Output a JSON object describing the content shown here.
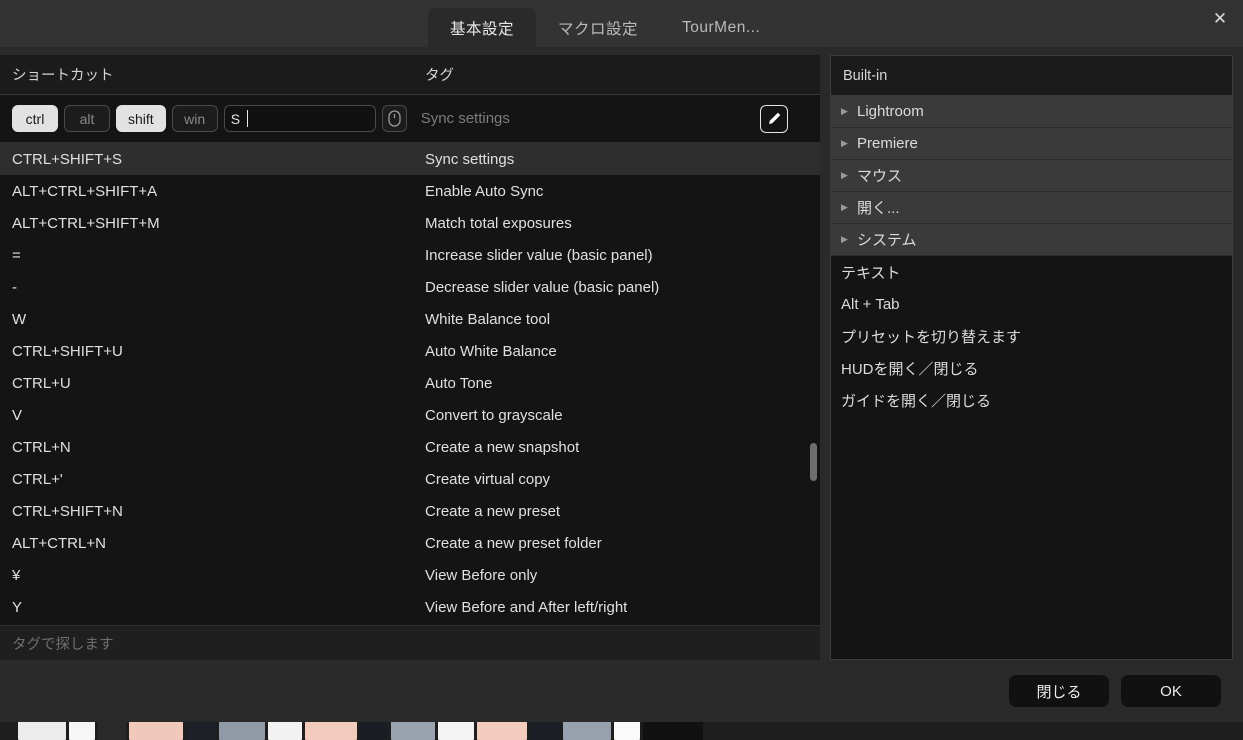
{
  "window": {
    "close_label": "✕"
  },
  "tabs": [
    {
      "label": "基本設定",
      "active": true
    },
    {
      "label": "マクロ設定",
      "active": false
    },
    {
      "label": "TourMen...",
      "active": false
    }
  ],
  "left_panel": {
    "columns": {
      "shortcut": "ショートカット",
      "tag": "タグ"
    },
    "editor": {
      "modifiers": [
        {
          "label": "ctrl",
          "active": true
        },
        {
          "label": "alt",
          "active": false
        },
        {
          "label": "shift",
          "active": true
        },
        {
          "label": "win",
          "active": false
        }
      ],
      "key_value": "S",
      "mouse_icon": "mouse-icon",
      "tag_value": "Sync settings",
      "edit_icon": "pencil-icon"
    },
    "rows": [
      {
        "shortcut": "CTRL+SHIFT+S",
        "tag": "Sync settings",
        "selected": true
      },
      {
        "shortcut": "ALT+CTRL+SHIFT+A",
        "tag": "Enable Auto Sync",
        "selected": false
      },
      {
        "shortcut": "ALT+CTRL+SHIFT+M",
        "tag": "Match total exposures",
        "selected": false
      },
      {
        "shortcut": "=",
        "tag": "Increase slider value (basic panel)",
        "selected": false
      },
      {
        "shortcut": "-",
        "tag": "Decrease slider value (basic panel)",
        "selected": false
      },
      {
        "shortcut": "W",
        "tag": "White Balance tool",
        "selected": false
      },
      {
        "shortcut": "CTRL+SHIFT+U",
        "tag": "Auto White Balance",
        "selected": false
      },
      {
        "shortcut": "CTRL+U",
        "tag": "Auto Tone",
        "selected": false
      },
      {
        "shortcut": "V",
        "tag": "Convert to grayscale",
        "selected": false
      },
      {
        "shortcut": "CTRL+N",
        "tag": "Create a new snapshot",
        "selected": false
      },
      {
        "shortcut": "CTRL+'",
        "tag": "Create virtual copy",
        "selected": false
      },
      {
        "shortcut": "CTRL+SHIFT+N",
        "tag": "Create a new preset",
        "selected": false
      },
      {
        "shortcut": "ALT+CTRL+N",
        "tag": "Create a new preset folder",
        "selected": false
      },
      {
        "shortcut": "¥",
        "tag": "View Before only",
        "selected": false
      },
      {
        "shortcut": "Y",
        "tag": "View Before and After left/right",
        "selected": false
      }
    ],
    "tag_search_placeholder": "タグで探します"
  },
  "right_panel": {
    "header": "Built-in",
    "tree": [
      {
        "label": "Lightroom",
        "group": true
      },
      {
        "label": "Premiere",
        "group": true
      },
      {
        "label": "マウス",
        "group": true
      },
      {
        "label": "開く...",
        "group": true
      },
      {
        "label": "システム",
        "group": true
      },
      {
        "label": "テキスト",
        "group": false
      },
      {
        "label": "Alt + Tab",
        "group": false
      },
      {
        "label": "プリセットを切り替えます",
        "group": false
      },
      {
        "label": "HUDを開く／閉じる",
        "group": false
      },
      {
        "label": "ガイドを開く／閉じる",
        "group": false
      }
    ]
  },
  "footer": {
    "close_button": "閉じる",
    "ok_button": "OK"
  },
  "colors": {
    "dialog_bg": "#2a2a2a",
    "titlebar_bg": "#333333",
    "pane_bg": "#141414",
    "header_bg": "#1b1b1b",
    "row_selected": "#2e2e2e",
    "tree_group_bg": "#3a3a3a",
    "text_primary": "#e0e0e0",
    "text_muted": "#7c7c7c",
    "modkey_active_bg": "#e2e2e2"
  },
  "background_thumbnails": {
    "top": [
      "#e8e6e4",
      "#2f2f31",
      "#f1cfc4",
      "#3d5a78",
      "#efe9e6",
      "#262729",
      "#1d2026",
      "#4a4f58",
      "#fbfbfb",
      "#f0c6ad",
      "#e8a98a",
      "#2b3a4c",
      "#e9c9c0",
      "#dde1e6",
      "#2a2c30"
    ],
    "bottom": [
      "#ececec",
      "#f6f6f6",
      "#2a2a2a",
      "#f0c9bb",
      "#1d2127",
      "#8f9aa6",
      "#f2f2f2",
      "#f3cbbd",
      "#1a1e24",
      "#9aa4b0",
      "#f4f4f4",
      "#f3ccbe",
      "#1b1f25",
      "#98a2ae",
      "#fafafa",
      "#111111"
    ]
  }
}
